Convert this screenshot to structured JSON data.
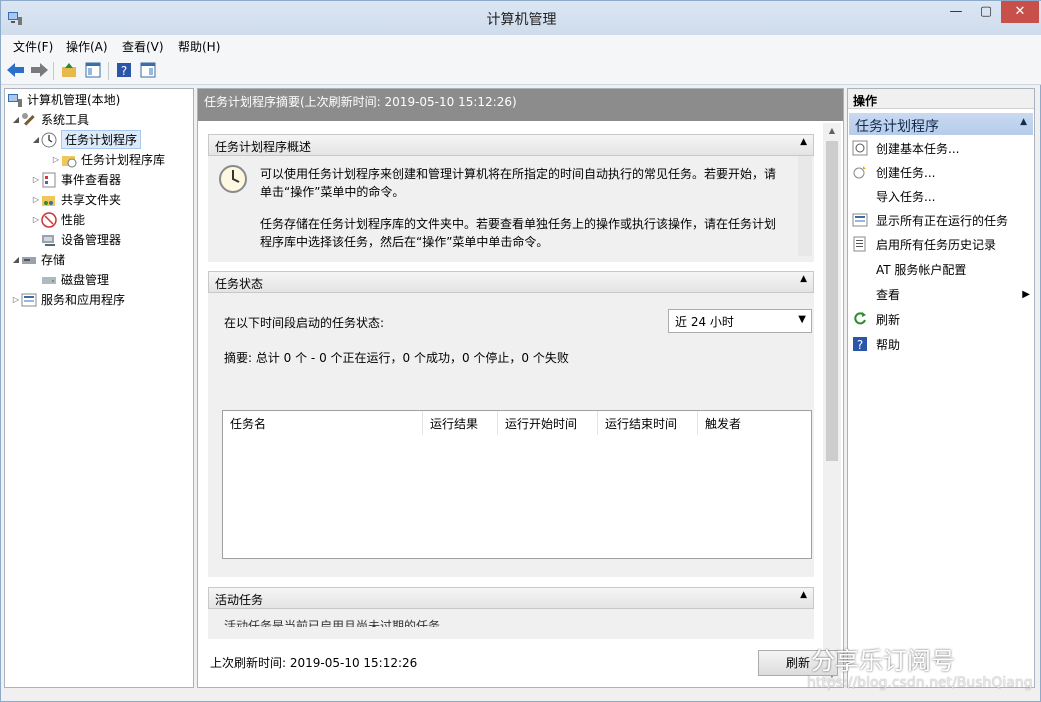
{
  "window": {
    "title": "计算机管理",
    "minimize": "—",
    "maximize": "▢",
    "close": "✕"
  },
  "menu": [
    "文件(F)",
    "操作(A)",
    "查看(V)",
    "帮助(H)"
  ],
  "tree": {
    "root": "计算机管理(本地)",
    "system_tools": "系统工具",
    "task_scheduler": "任务计划程序",
    "task_library": "任务计划程序库",
    "event_viewer": "事件查看器",
    "shared_folders": "共享文件夹",
    "performance": "性能",
    "device_manager": "设备管理器",
    "storage": "存储",
    "disk_management": "磁盘管理",
    "services_apps": "服务和应用程序"
  },
  "center": {
    "header": "任务计划程序摘要(上次刷新时间: 2019-05-10 15:12:26)",
    "overview": {
      "title": "任务计划程序概述",
      "line1": "可以使用任务计划程序来创建和管理计算机将在所指定的时间自动执行的常见任务。若要开始，请",
      "line2": "单击“操作”菜单中的命令。",
      "line3": "任务存储在任务计划程序库的文件夹中。若要查看单独任务上的操作或执行该操作，请在任务计划",
      "line4": "程序库中选择该任务，然后在“操作”菜单中单击命令。"
    },
    "status": {
      "title": "任务状态",
      "label": "在以下时间段启动的任务状态:",
      "period": "近 24 小时",
      "summary": "摘要: 总计 0 个 - 0 个正在运行，0 个成功，0 个停止，0 个失败",
      "columns": [
        "任务名",
        "运行结果",
        "运行开始时间",
        "运行结束时间",
        "触发者"
      ]
    },
    "active": {
      "title": "活动任务",
      "partial": "活动任务是当前已启用且尚未过期的任务。"
    },
    "footer": "上次刷新时间: 2019-05-10 15:12:26",
    "refresh": "刷新"
  },
  "actions": {
    "header": "操作",
    "section": "任务计划程序",
    "items": [
      "创建基本任务...",
      "创建任务...",
      "导入任务...",
      "显示所有正在运行的任务",
      "启用所有任务历史记录",
      "AT 服务帐户配置",
      "查看",
      "刷新",
      "帮助"
    ]
  },
  "watermark": {
    "text": "分享乐订阅号",
    "url": "https://blog.csdn.net/BushQiang"
  }
}
